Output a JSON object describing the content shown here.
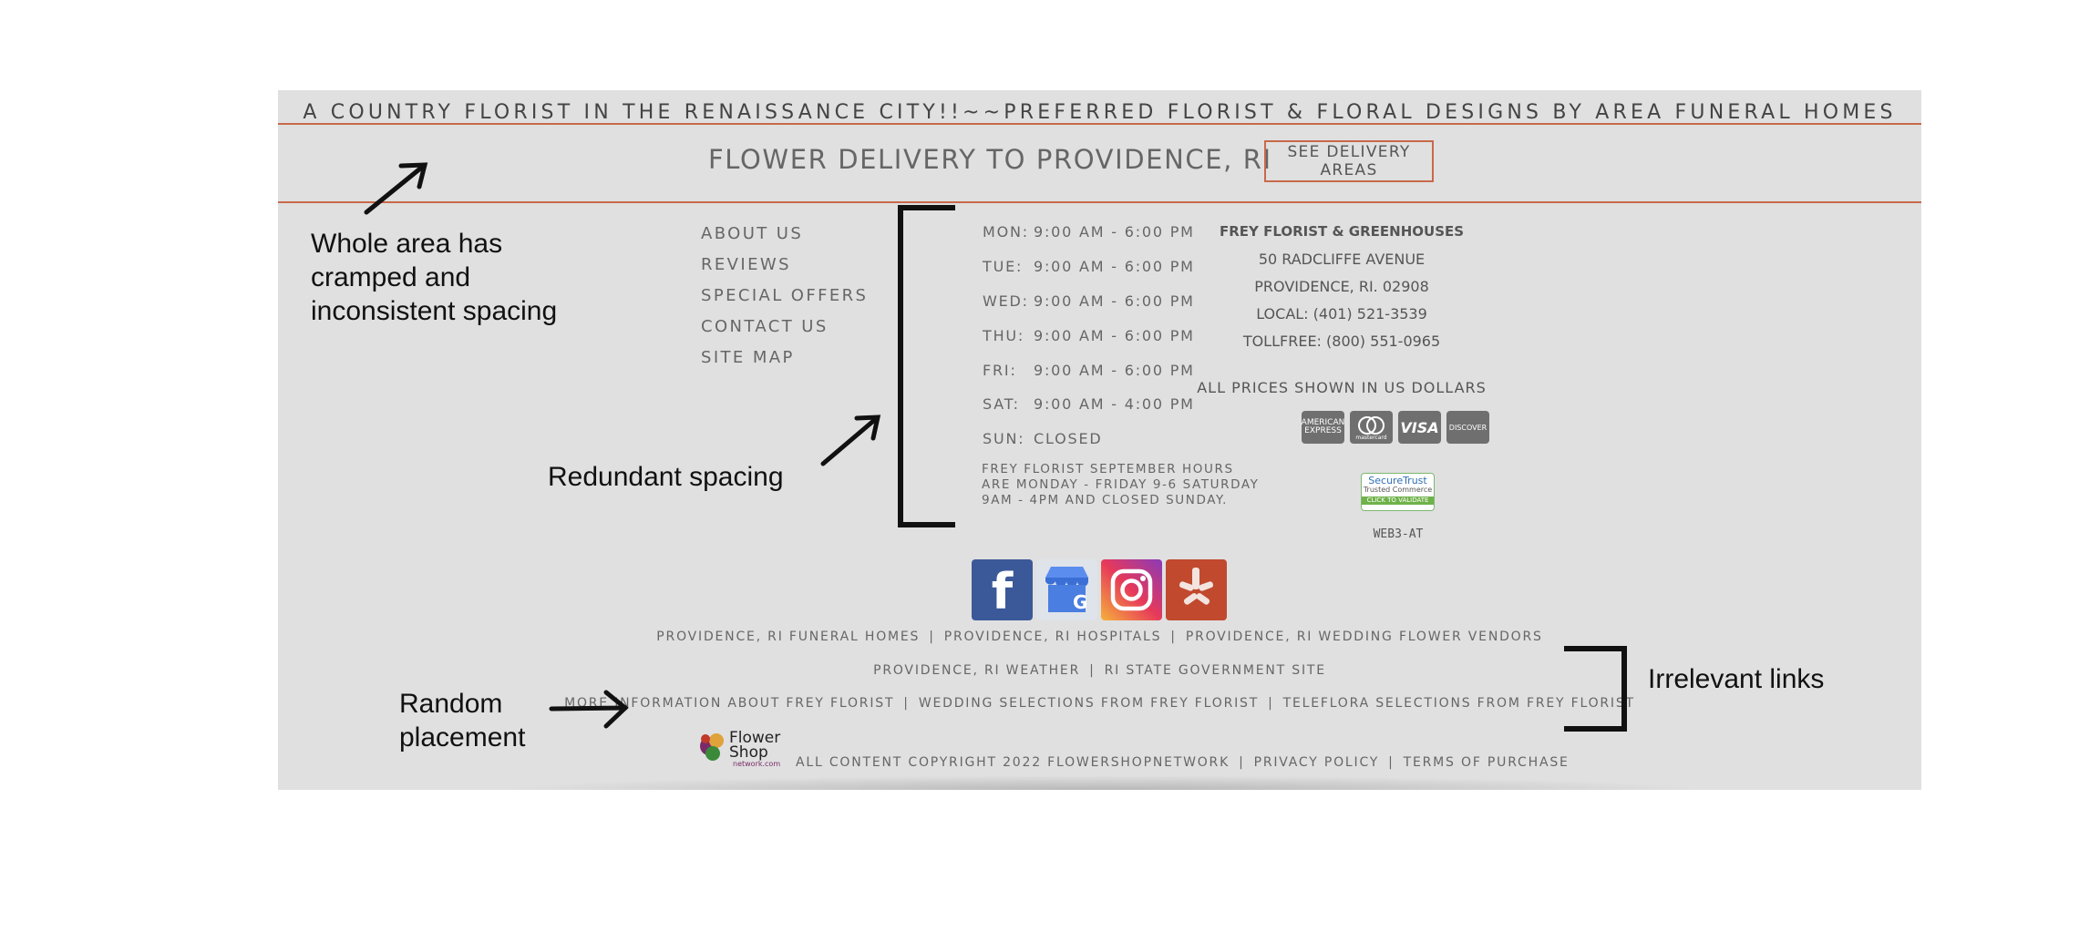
{
  "tagline": "A COUNTRY FLORIST IN THE RENAISSANCE CITY!!~~PREFERRED FLORIST & FLORAL DESIGNS BY AREA FUNERAL HOMES",
  "delivery": {
    "title": "FLOWER DELIVERY TO PROVIDENCE, RI",
    "button_label": "SEE DELIVERY AREAS"
  },
  "nav_links": [
    "ABOUT US",
    "REVIEWS",
    "SPECIAL OFFERS",
    "CONTACT US",
    "SITE MAP"
  ],
  "hours": [
    {
      "day": "MON:",
      "time": "9:00 AM - 6:00 PM"
    },
    {
      "day": "TUE:",
      "time": "9:00 AM - 6:00 PM"
    },
    {
      "day": "WED:",
      "time": "9:00 AM - 6:00 PM"
    },
    {
      "day": "THU:",
      "time": "9:00 AM - 6:00 PM"
    },
    {
      "day": "FRI:",
      "time": "9:00 AM - 6:00 PM"
    },
    {
      "day": "SAT:",
      "time": "9:00 AM - 4:00 PM"
    },
    {
      "day": "SUN:",
      "time": "CLOSED"
    }
  ],
  "hours_note": "FREY FLORIST SEPTEMBER HOURS ARE MONDAY - FRIDAY 9-6 SATURDAY 9AM - 4PM AND CLOSED SUNDAY.",
  "contact": {
    "name": "FREY FLORIST & GREENHOUSES",
    "street": "50 RADCLIFFE AVENUE",
    "city": "PROVIDENCE, RI. 02908",
    "local": "LOCAL: (401) 521-3539",
    "tollfree": "TOLLFREE: (800) 551-0965",
    "prices_note": "ALL PRICES SHOWN IN US DOLLARS"
  },
  "payment_cards": {
    "amex": "AMERICAN EXPRESS",
    "mastercard": "mastercard",
    "visa": "VISA",
    "discover": "DISCOVER"
  },
  "secure_trust": {
    "line1": "SecureTrust",
    "line2": "Trusted Commerce",
    "line3": "CLICK TO VALIDATE"
  },
  "web_code": "WEB3-AT",
  "social": {
    "facebook": "f",
    "google": "G",
    "instagram": "",
    "yelp": ""
  },
  "link_rows": [
    [
      "PROVIDENCE, RI FUNERAL HOMES",
      "PROVIDENCE, RI HOSPITALS",
      "PROVIDENCE, RI WEDDING FLOWER VENDORS"
    ],
    [
      "PROVIDENCE, RI WEATHER",
      "RI STATE GOVERNMENT SITE"
    ],
    [
      "MORE INFORMATION ABOUT FREY FLORIST",
      "WEDDING SELECTIONS FROM FREY FLORIST",
      "TELEFLORA SELECTIONS FROM FREY FLORIST"
    ]
  ],
  "logo": {
    "line1": "Flower",
    "line2": "Shop",
    "line3": "network.com"
  },
  "copyright": {
    "text": "ALL CONTENT COPYRIGHT 2022 FLOWERSHOPNETWORK",
    "privacy": "PRIVACY POLICY",
    "terms": "TERMS OF PURCHASE"
  },
  "separator": "|",
  "annotations": {
    "spacing": [
      "Whole area has",
      "cramped and",
      "inconsistent spacing"
    ],
    "redundant": "Redundant spacing",
    "random": [
      "Random",
      "placement"
    ],
    "irrelevant": "Irrelevant links"
  },
  "colors": {
    "accent": "#c8694a",
    "footer_bg": "#e0e0e0",
    "facebook": "#3b5998",
    "google": "#4a7ee0",
    "yelp": "#c0492e"
  }
}
